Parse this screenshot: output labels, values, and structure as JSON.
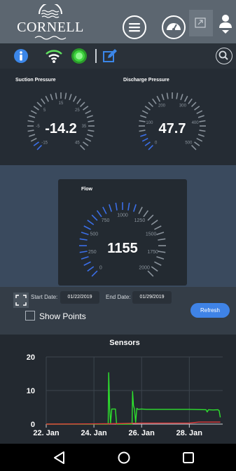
{
  "header": {
    "logo_text": "CORNELL",
    "menu_icon": "hamburger-menu-icon",
    "dashboard_icon": "speedometer-icon",
    "expand_icon": "expand-icon",
    "user_icon": "user-dropdown-icon"
  },
  "toolbar": {
    "icons": [
      "info-icon",
      "wifi-icon",
      "status-light-icon",
      "edit-icon",
      "search-icon"
    ],
    "colors": {
      "info": "#3b86e8",
      "wifi": "#5ee05e",
      "status": "#3fd33f",
      "edit": "#3b86e8"
    }
  },
  "gauges": [
    {
      "title": "Suction Pressure",
      "value": "-14.2",
      "ticks": [
        "-15",
        "-5",
        "5",
        "15",
        "25",
        "35",
        "45"
      ],
      "fraction": 0.01
    },
    {
      "title": "Discharge Pressure",
      "value": "47.7",
      "ticks": [
        "0",
        "100",
        "200",
        "300",
        "400",
        "500"
      ],
      "fraction": 0.095
    }
  ],
  "flow": {
    "title": "Flow",
    "value": "1155",
    "ticks": [
      "0",
      "250",
      "500",
      "750",
      "1000",
      "1250",
      "1500",
      "1750",
      "2000"
    ],
    "fraction": 0.5775
  },
  "controls": {
    "start_label": "Start Date:",
    "start_value": "01/22/2019",
    "end_label": "End Date:",
    "end_value": "01/29/2019",
    "refresh_label": "Refresh",
    "show_points_label": "Show Points"
  },
  "chart_data": {
    "type": "line",
    "title": "Sensors",
    "y_ticks": [
      "0",
      "10",
      "20"
    ],
    "x_ticks": [
      "22. Jan",
      "24. Jan",
      "26. Jan",
      "28. Jan"
    ],
    "ylim": [
      0,
      20
    ],
    "xlim": [
      0,
      7.4
    ],
    "grid": true,
    "series": [
      {
        "color": "#2ee02e",
        "x": [
          0,
          2.6,
          2.62,
          2.66,
          2.7,
          2.75,
          2.9,
          2.95,
          3.0,
          3.2,
          3.6,
          3.62,
          3.66,
          3.7,
          3.75,
          3.8,
          3.85,
          4.0,
          4.2,
          5.0,
          6.0,
          6.7,
          6.75,
          6.8,
          7.0,
          7.2,
          7.25,
          7.3
        ],
        "y": [
          0,
          0,
          15.3,
          4.5,
          0.3,
          4.5,
          4.5,
          0,
          0,
          0,
          0,
          9.7,
          5.5,
          4.5,
          0.5,
          4.7,
          4.4,
          4.5,
          4.4,
          4.4,
          4.4,
          4.3,
          3.6,
          4.3,
          4.2,
          4.3,
          4.0,
          2.0
        ]
      },
      {
        "color": "#e23b3b",
        "x": [
          0,
          2.7,
          4.0,
          6.0,
          6.4,
          7.3
        ],
        "y": [
          0,
          0.1,
          0.3,
          0.3,
          0.6,
          0.6
        ]
      }
    ]
  },
  "navbar": {
    "icons": [
      "back-triangle-icon",
      "home-circle-icon",
      "recents-square-icon"
    ]
  }
}
